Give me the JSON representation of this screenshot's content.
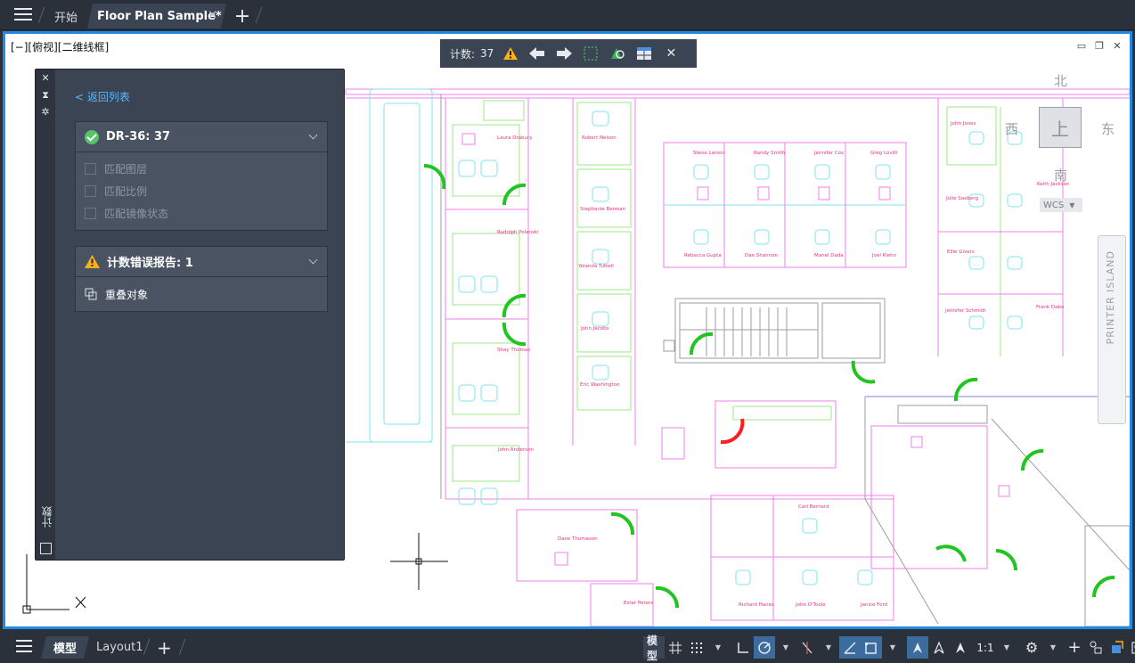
{
  "top_tabs": {
    "menu_icon": "hamburger-icon",
    "start": "开始",
    "active": "Floor Plan Sample*",
    "close": "✕",
    "plus": "+"
  },
  "viewport": {
    "label": "[−][俯视][二维线框]",
    "accent": "#1e8ae5"
  },
  "count_toolbar": {
    "label": "计数:",
    "value": "37",
    "icons": [
      "warning-icon",
      "prev-arrow-icon",
      "next-arrow-icon",
      "zoom-to-selection-icon",
      "find-icon",
      "insert-table-icon",
      "close-icon"
    ]
  },
  "palette": {
    "strip_icons": [
      "close-icon",
      "auto-hide-icon",
      "properties-icon"
    ],
    "vertical_title": "计数",
    "back": "< 返回列表",
    "block": {
      "title": "DR-36: 37",
      "options": [
        "匹配图层",
        "匹配比例",
        "匹配镜像状态"
      ]
    },
    "errors": {
      "title": "计数错误报告:  1",
      "item": "重叠对象"
    }
  },
  "viewcube": {
    "top": "上",
    "north": "北",
    "south": "南",
    "east": "东",
    "west": "西",
    "wcs": "WCS"
  },
  "navbar": {
    "text": "PRINTER ISLAND"
  },
  "drawing": {
    "labels": [
      {
        "text": "Laura Drabury",
        "color": "#e8327a"
      },
      {
        "text": "Robert Nelson",
        "color": "#e8327a"
      },
      {
        "text": "Stephanie Berman",
        "color": "#e8327a"
      },
      {
        "text": "Rudolph Polenski",
        "color": "#e8327a"
      },
      {
        "text": "Yolanda Tuttell",
        "color": "#e8327a"
      },
      {
        "text": "John Jacobs",
        "color": "#e8327a"
      },
      {
        "text": "Shay Thomas",
        "color": "#e8327a"
      },
      {
        "text": "Eric Washington",
        "color": "#e8327a"
      },
      {
        "text": "John Anderson",
        "color": "#e8327a"
      },
      {
        "text": "Steve Larson",
        "color": "#e8327a"
      },
      {
        "text": "Randy Smith",
        "color": "#e8327a"
      },
      {
        "text": "Jennifer Cox",
        "color": "#e8327a"
      },
      {
        "text": "Greg Lovitt",
        "color": "#e8327a"
      },
      {
        "text": "Rebecca Gupta",
        "color": "#e8327a"
      },
      {
        "text": "Dan Shannon",
        "color": "#e8327a"
      },
      {
        "text": "Manel Dada",
        "color": "#e8327a"
      },
      {
        "text": "Joel Klehn",
        "color": "#e8327a"
      },
      {
        "text": "John Jones",
        "color": "#e8327a"
      },
      {
        "text": "Julie Saxberg",
        "color": "#e8327a"
      },
      {
        "text": "Keith Jackson",
        "color": "#e8327a"
      },
      {
        "text": "Ellie Givers",
        "color": "#e8327a"
      },
      {
        "text": "Jennifer Schmidt",
        "color": "#e8327a"
      },
      {
        "text": "Frank Dabo",
        "color": "#e8327a"
      },
      {
        "text": "Dave Thomason",
        "color": "#e8327a"
      },
      {
        "text": "Carl Bernard",
        "color": "#e8327a"
      },
      {
        "text": "Richard Hanes",
        "color": "#e8327a"
      },
      {
        "text": "John O'Toole",
        "color": "#e8327a"
      },
      {
        "text": "Janice Ford",
        "color": "#e8327a"
      },
      {
        "text": "Ester Peters",
        "color": "#e8327a"
      }
    ]
  },
  "bottom_tabs": {
    "menu_icon": "hamburger-icon",
    "model": "模型",
    "layout": "Layout1",
    "plus": "+"
  },
  "status_bar": {
    "model": "模型",
    "scale": "1:1",
    "icons": [
      "grid-icon",
      "snap-icon",
      "ortho-icon",
      "polar-icon",
      "isodraft-icon",
      "osnap-icon",
      "lineweight-icon",
      "annotation-visibility-icon",
      "autoscale-icon",
      "annotation-scale-icon",
      "gear-icon",
      "plus-icon",
      "isolate-icon",
      "hardware-accel-icon",
      "fullscreen-icon",
      "customize-icon"
    ]
  }
}
